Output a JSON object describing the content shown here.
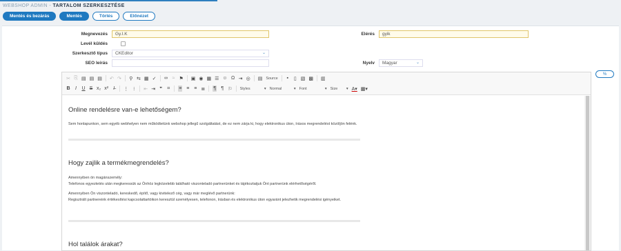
{
  "breadcrumb": {
    "root": "WEBSHOP ADMIN",
    "separator": "-",
    "current": "TARTALOM SZERKESZTÉSE"
  },
  "buttons": {
    "save_close": "Mentés és bezárás",
    "save": "Mentés",
    "delete": "Törlés",
    "preview": "Előnézet"
  },
  "form": {
    "name_label": "Megnevezés",
    "name_value": "Gy.I.K",
    "path_label": "Elérés",
    "path_value": "gyik",
    "mail_label": "Levél küldés",
    "editor_type_label": "Szerkesztő típus",
    "editor_type_value": "CKEditor",
    "seo_label": "SEO leírás",
    "seo_value": "",
    "lang_label": "Nyelv",
    "lang_value": "Magyar"
  },
  "toolbar": {
    "row1": [
      "✂",
      "⎘",
      "📋",
      "📋",
      "📋",
      "↶",
      "↷",
      "🔍",
      "⇄",
      "▦",
      "ABC",
      "🔗",
      "⛓",
      "⚑",
      "🖼",
      "◉",
      "▦",
      "☰",
      "☺",
      "Ω",
      "⇥",
      "◎",
      "Source",
      "💾",
      "🗋",
      "🔎",
      "🖶",
      "▣"
    ],
    "source_label": "Source",
    "styles_label": "Styles",
    "format_label": "Normal",
    "font_label": "Font",
    "size_label": "Size"
  },
  "content": {
    "h1": "Online rendelésre van-e lehetőségem?",
    "p1": "Sem honlapunkon, sem egyéb webhelyen nem működtetünk webshop jellegű szolgáltatást, de ez nem zárja ki, hogy elektronikus úton, írásos megrendelést közöljön felénk.",
    "h2": "Hogy zajlik a termékmegrendelés?",
    "p2a": "Amennyiben ön magánszemély:",
    "p2b": "Telefonos egyeztetés után megkeressük az Önhöz legközelebb található viszonteladó partnerünket és tájékoztatjuk Önt partnerünk elérhetőségéről.",
    "p2c": "Amennyiben Ön viszonteladó, kereskedő, építő, vagy kivitelező cég, vagy már meglévő partnerünk:",
    "p2d": "Regisztrált partnereink értékesítési kapcsolattartóikon keresztül személyesen, telefonon, írásban és elektronikus úton egyaránt jelezhetik megrendelési igényeiket.",
    "h3": "Hol találok árakat?"
  },
  "side_button": "%"
}
